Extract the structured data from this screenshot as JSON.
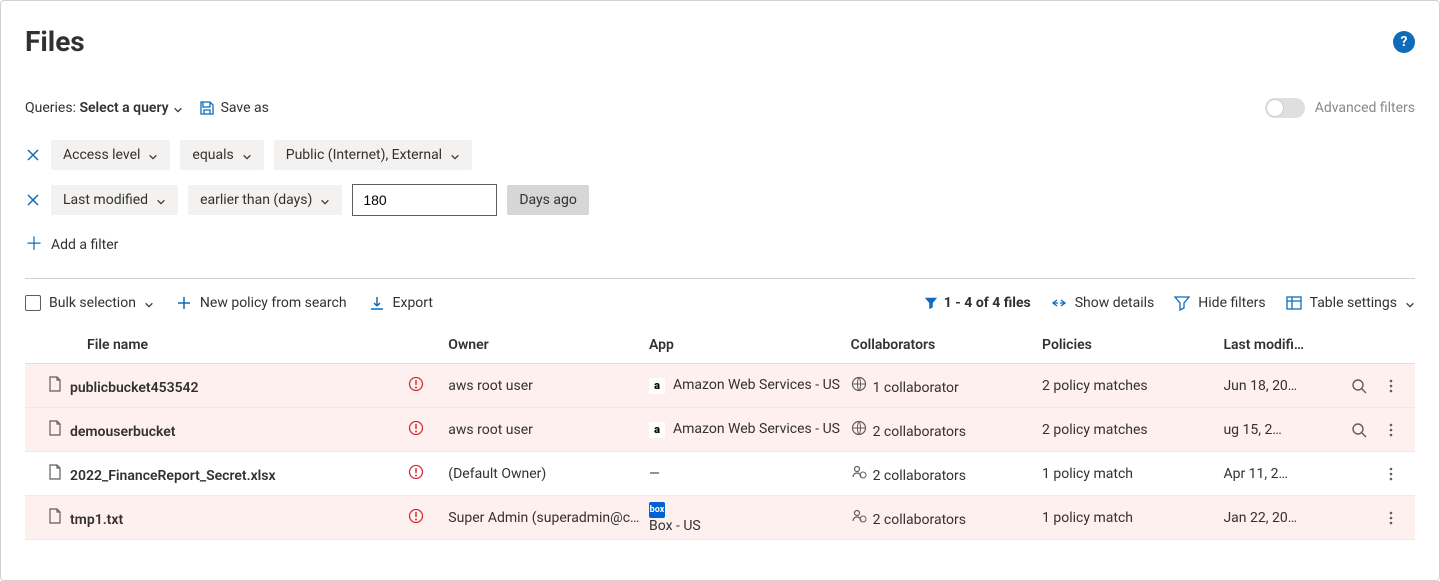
{
  "header": {
    "title": "Files"
  },
  "query": {
    "label_prefix": "Queries:",
    "select_label": "Select a query",
    "save_as": "Save as",
    "advanced_filters": "Advanced filters"
  },
  "filters": {
    "rows": [
      {
        "field": "Access level",
        "operator": "equals",
        "value": "Public (Internet), External"
      },
      {
        "field": "Last modified",
        "operator": "earlier than (days)",
        "input_value": "180",
        "suffix_chip": "Days ago"
      }
    ],
    "add_label": "Add a filter"
  },
  "toolbar": {
    "bulk_selection": "Bulk selection",
    "new_policy": "New policy from search",
    "export": "Export",
    "results": "1 - 4 of 4 files",
    "show_details": "Show details",
    "hide_filters": "Hide filters",
    "table_settings": "Table settings"
  },
  "table": {
    "headers": {
      "file_name": "File name",
      "owner": "Owner",
      "app": "App",
      "collaborators": "Collaborators",
      "policies": "Policies",
      "last_modified": "Last modifi…"
    },
    "rows": [
      {
        "file_name": "publicbucket453542",
        "owner": "aws root user",
        "owner_warn": true,
        "app_icon": "aws",
        "app": "Amazon Web Services - US",
        "collab_icon": "globe",
        "collaborators": "1 collaborator",
        "policies": "2 policy matches",
        "last_modified": "Jun 18, 20…",
        "has_search": true
      },
      {
        "file_name": "demouserbucket",
        "owner": "aws root user",
        "owner_warn": true,
        "app_icon": "aws",
        "app": "Amazon Web Services - US",
        "collab_icon": "globe",
        "collaborators": "2 collaborators",
        "policies": "2 policy matches",
        "last_modified": "ug 15, 2…",
        "has_search": true
      },
      {
        "file_name": "2022_FinanceReport_Secret.xlsx",
        "owner": "(Default Owner)",
        "owner_warn": true,
        "app_icon": "dash",
        "app": "—",
        "collab_icon": "person-globe",
        "collaborators": "2 collaborators",
        "policies": "1 policy match",
        "last_modified": "Apr 11, 2…",
        "has_search": false
      },
      {
        "file_name": "tmp1.txt",
        "owner": "Super Admin (superadmin@c…",
        "owner_warn": true,
        "app_icon": "box",
        "app": "Box - US",
        "collab_icon": "person-globe",
        "collaborators": "2 collaborators",
        "policies": "1 policy match",
        "last_modified": "Jan 22, 20…",
        "has_search": false
      }
    ]
  }
}
